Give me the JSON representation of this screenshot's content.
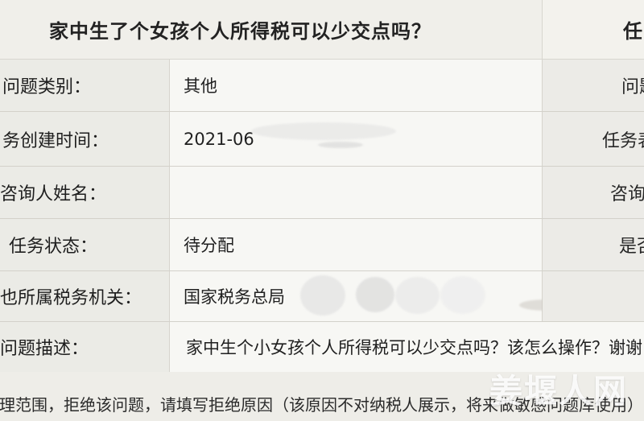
{
  "header": {
    "title": "家中生了个女孩个人所得税可以少交点吗？",
    "right_label": "任"
  },
  "rows": [
    {
      "label": "问题类别：",
      "value": "其他",
      "right_label": "问题"
    },
    {
      "label": "务创建时间：",
      "value": "2021-06",
      "right_label": "任务表"
    },
    {
      "label": "咨询人姓名：",
      "value": "",
      "right_label": "咨询"
    },
    {
      "label": "任务状态：",
      "value": "待分配",
      "right_label": "是否"
    },
    {
      "label": "也所属税务机关：",
      "value": "国家税务总局",
      "right_label": ""
    },
    {
      "label": "问题描述：",
      "value": "家中生个小女孩个人所得税可以少交点吗？该怎么操作？谢谢",
      "right_label": ""
    }
  ],
  "footer": {
    "text": "理范围，拒绝该问题，请填写拒绝原因（该原因不对纳税人展示，将来做敏感问题库使用）"
  },
  "watermark": {
    "text": "姜堰人网"
  }
}
